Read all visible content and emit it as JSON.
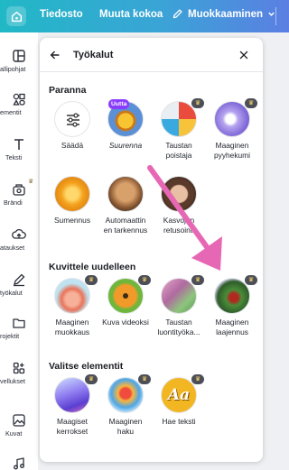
{
  "topbar": {
    "file_label": "Tiedosto",
    "resize_label": "Muuta kokoa",
    "edit_label": "Muokkaaminen"
  },
  "sidebar": {
    "items": [
      {
        "label": "allipohjat",
        "icon": "layout-icon"
      },
      {
        "label": "ementit",
        "icon": "shapes-icon"
      },
      {
        "label": "Teksti",
        "icon": "text-icon"
      },
      {
        "label": "Brändi",
        "icon": "brand-icon"
      },
      {
        "label": "ataukset",
        "icon": "upload-icon"
      },
      {
        "label": "työkalut",
        "icon": "pen-icon"
      },
      {
        "label": "rojektit",
        "icon": "folder-icon"
      },
      {
        "label": "vellukset",
        "icon": "apps-icon"
      },
      {
        "label": "Kuvat",
        "icon": "image-icon"
      },
      {
        "label": "",
        "icon": "music-icon"
      }
    ]
  },
  "panel": {
    "title": "Työkalut",
    "sections": {
      "enhance": {
        "title": "Paranna",
        "tools": [
          {
            "label": "Säädä",
            "icon": "sliders-icon"
          },
          {
            "label": "Suurenna",
            "badge": "Uutta"
          },
          {
            "label": "Taustan poistaja"
          },
          {
            "label": "Maaginen pyyhekumi"
          },
          {
            "label": "Sumennus"
          },
          {
            "label": "Automaattin en tarkennus"
          },
          {
            "label": "Kasvojen retusointi"
          }
        ]
      },
      "imagine": {
        "title": "Kuvittele uudelleen",
        "tools": [
          {
            "label": "Maaginen muokkaus"
          },
          {
            "label": "Kuva videoksi"
          },
          {
            "label": "Taustan luontityökа..."
          },
          {
            "label": "Maaginen laajennus"
          }
        ]
      },
      "select": {
        "title": "Valitse elementit",
        "tools": [
          {
            "label": "Maagiset kerrokset"
          },
          {
            "label": "Maaginen haku"
          },
          {
            "label": "Hae teksti",
            "icon_text": "Aa"
          }
        ]
      }
    }
  },
  "colors": {
    "accent_purple": "#8b3dff",
    "arrow_pink": "#e668b4"
  }
}
